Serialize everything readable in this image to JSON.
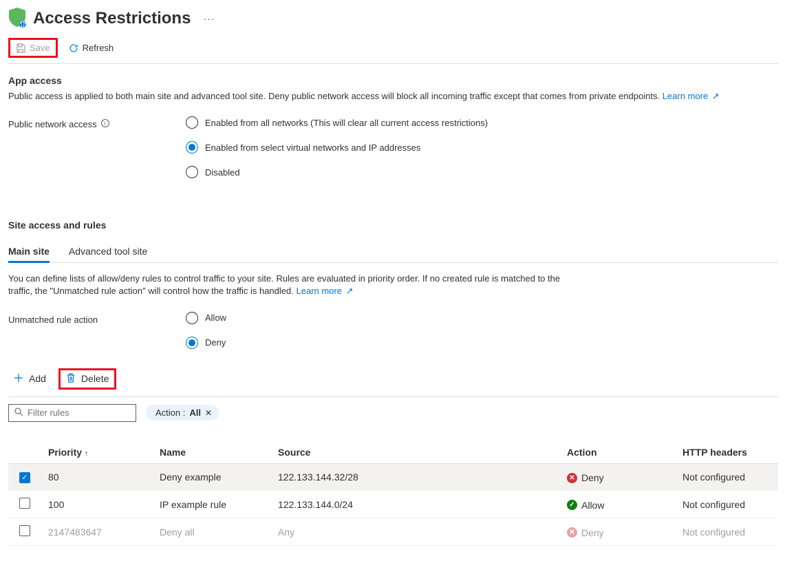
{
  "header": {
    "title": "Access Restrictions",
    "ellipsis": "···"
  },
  "commandBar": {
    "save_label": "Save",
    "refresh_label": "Refresh"
  },
  "appAccess": {
    "section_title": "App access",
    "description": "Public access is applied to both main site and advanced tool site. Deny public network access will block all incoming traffic except that comes from private endpoints.",
    "learn_more": "Learn more",
    "pna_label": "Public network access",
    "options": {
      "enabled_all": "Enabled from all networks (This will clear all current access restrictions)",
      "enabled_select": "Enabled from select virtual networks and IP addresses",
      "disabled": "Disabled"
    },
    "selected": "enabled_select"
  },
  "siteAccess": {
    "section_title": "Site access and rules",
    "tabs": {
      "main": "Main site",
      "adv": "Advanced tool site"
    },
    "active_tab": "main",
    "description": "You can define lists of allow/deny rules to control traffic to your site. Rules are evaluated in priority order. If no created rule is matched to the traffic, the \"Unmatched rule action\" will control how the traffic is handled.",
    "learn_more": "Learn more",
    "unmatched_label": "Unmatched rule action",
    "unmatched_options": {
      "allow": "Allow",
      "deny": "Deny"
    },
    "unmatched_selected": "deny"
  },
  "rulesToolbar": {
    "add": "Add",
    "delete": "Delete"
  },
  "filterBar": {
    "placeholder": "Filter rules",
    "chip_label": "Action :",
    "chip_value": "All"
  },
  "rulesTable": {
    "columns": {
      "priority": "Priority",
      "name": "Name",
      "source": "Source",
      "action": "Action",
      "http_headers": "HTTP headers"
    },
    "rows": [
      {
        "checked": true,
        "priority": "80",
        "name": "Deny example",
        "source": "122.133.144.32/28",
        "action": "Deny",
        "status": "deny",
        "headers": "Not configured",
        "selected": true
      },
      {
        "checked": false,
        "priority": "100",
        "name": "IP example rule",
        "source": "122.133.144.0/24",
        "action": "Allow",
        "status": "allow",
        "headers": "Not configured",
        "selected": false
      },
      {
        "checked": false,
        "priority": "2147483647",
        "name": "Deny all",
        "source": "Any",
        "action": "Deny",
        "status": "deny",
        "headers": "Not configured",
        "selected": false,
        "muted": true
      }
    ]
  }
}
